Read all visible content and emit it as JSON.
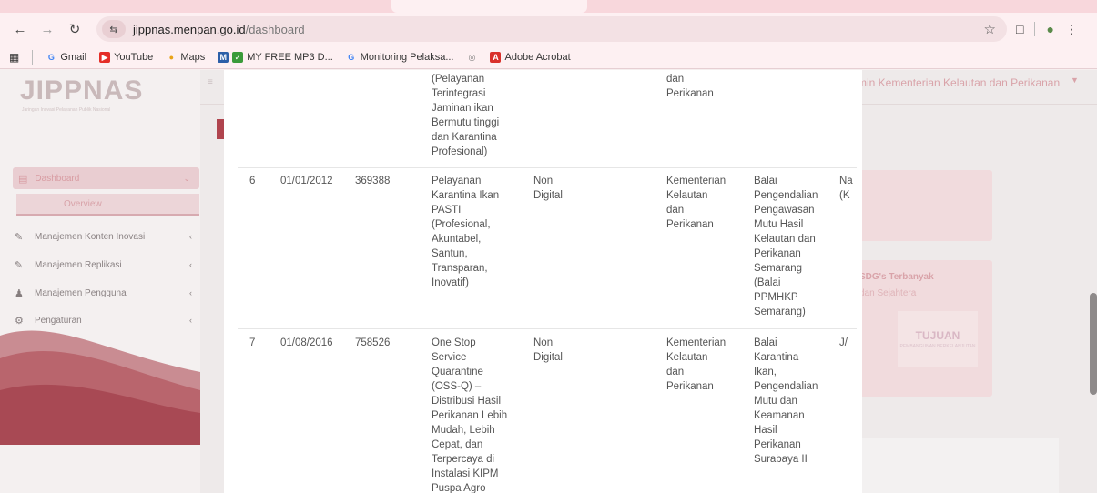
{
  "browser": {
    "url_host": "jippnas.menpan.go.id",
    "url_path": "/dashboard",
    "bookmarks": [
      "Gmail",
      "YouTube",
      "Maps",
      "MY FREE MP3 D...",
      "Monitoring Pelaksa...",
      "Adobe Acrobat"
    ]
  },
  "app": {
    "logo_text": "JIPPNAS",
    "logo_subtitle": "Jaringan Inovasi Pelayanan Publik Nasional",
    "user_label": "min Kementerian Kelautan dan Perikanan",
    "sidebar": {
      "dashboard": "Dashboard",
      "overview": "Overview",
      "items": [
        "Manajemen Konten Inovasi",
        "Manajemen Replikasi",
        "Manajemen Pengguna",
        "Pengaturan"
      ]
    },
    "sdg_title": "SDG's Terbanyak",
    "sdg_subtitle": "dan Sejahtera",
    "sdg_badge": "TUJUAN",
    "sdg_badge_sub": "PEMBANGUNAN BERKELANJUTAN"
  },
  "table": {
    "top_fragment": {
      "name": "(Pelayanan\nTerintegrasi\nJaminan ikan\nBermutu tinggi\ndan Karantina\nProfesional)",
      "instansi": "dan\nPerikanan"
    },
    "rows": [
      {
        "no": "6",
        "date": "01/01/2012",
        "id": "369388",
        "name": "Pelayanan\nKarantina Ikan\nPASTI\n(Profesional,\nAkuntabel,\nSantun,\nTransparan,\nInovatif)",
        "jenis": "Non\nDigital",
        "instansi": "Kementerian\nKelautan\ndan\nPerikanan",
        "unit": "Balai\nPengendalian\nPengawasan\nMutu Hasil\nKelautan dan\nPerikanan\nSemarang\n(Balai\nPPMHKP\nSemarang)",
        "extra": "Nа\n(K"
      },
      {
        "no": "7",
        "date": "01/08/2016",
        "id": "758526",
        "name": "One Stop\nService\nQuarantine\n(OSS-Q) –\nDistribusi Hasil\nPerikanan Lebih\nMudah, Lebih\nCepat, dan\nTerpercaya di\nInstalasi KIPM\nPuspa Agro",
        "jenis": "Non\nDigital",
        "instansi": "Kementerian\nKelautan\ndan\nPerikanan",
        "unit": "Balai\nKarantina\nIkan,\nPengendalian\nMutu dan\nKeamanan\nHasil\nPerikanan\nSurabaya II",
        "extra": "J/"
      }
    ]
  }
}
